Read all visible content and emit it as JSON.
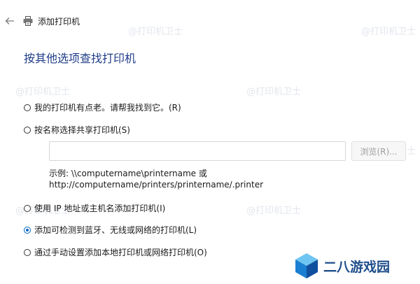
{
  "window": {
    "title": "添加打印机"
  },
  "page": {
    "title": "按其他选项查找打印机"
  },
  "options": [
    {
      "label": "我的打印机有点老。请帮我找到它。(R)",
      "checked": false
    },
    {
      "label": "按名称选择共享打印机(S)",
      "checked": false
    },
    {
      "label": "使用 IP 地址或主机名添加打印机(I)",
      "checked": false
    },
    {
      "label": "添加可检测到蓝牙、无线或网络的打印机(L)",
      "checked": true
    },
    {
      "label": "通过手动设置添加本地打印机或网络打印机(O)",
      "checked": false
    }
  ],
  "share": {
    "input_value": "",
    "browse_label": "浏览(R)...",
    "example_line1": "示例: \\\\computername\\printername 或",
    "example_line2": "http://computername/printers/printername/.printer"
  },
  "watermark": "@打印机卫士",
  "logo": {
    "text": "二八游戏园"
  },
  "colors": {
    "accent": "#0067c0",
    "title": "#1f3c88",
    "logo": "#1f4e8c"
  },
  "icons": {
    "back": "back-arrow-icon",
    "printer": "printer-icon",
    "logo": "cube-logo-icon"
  }
}
